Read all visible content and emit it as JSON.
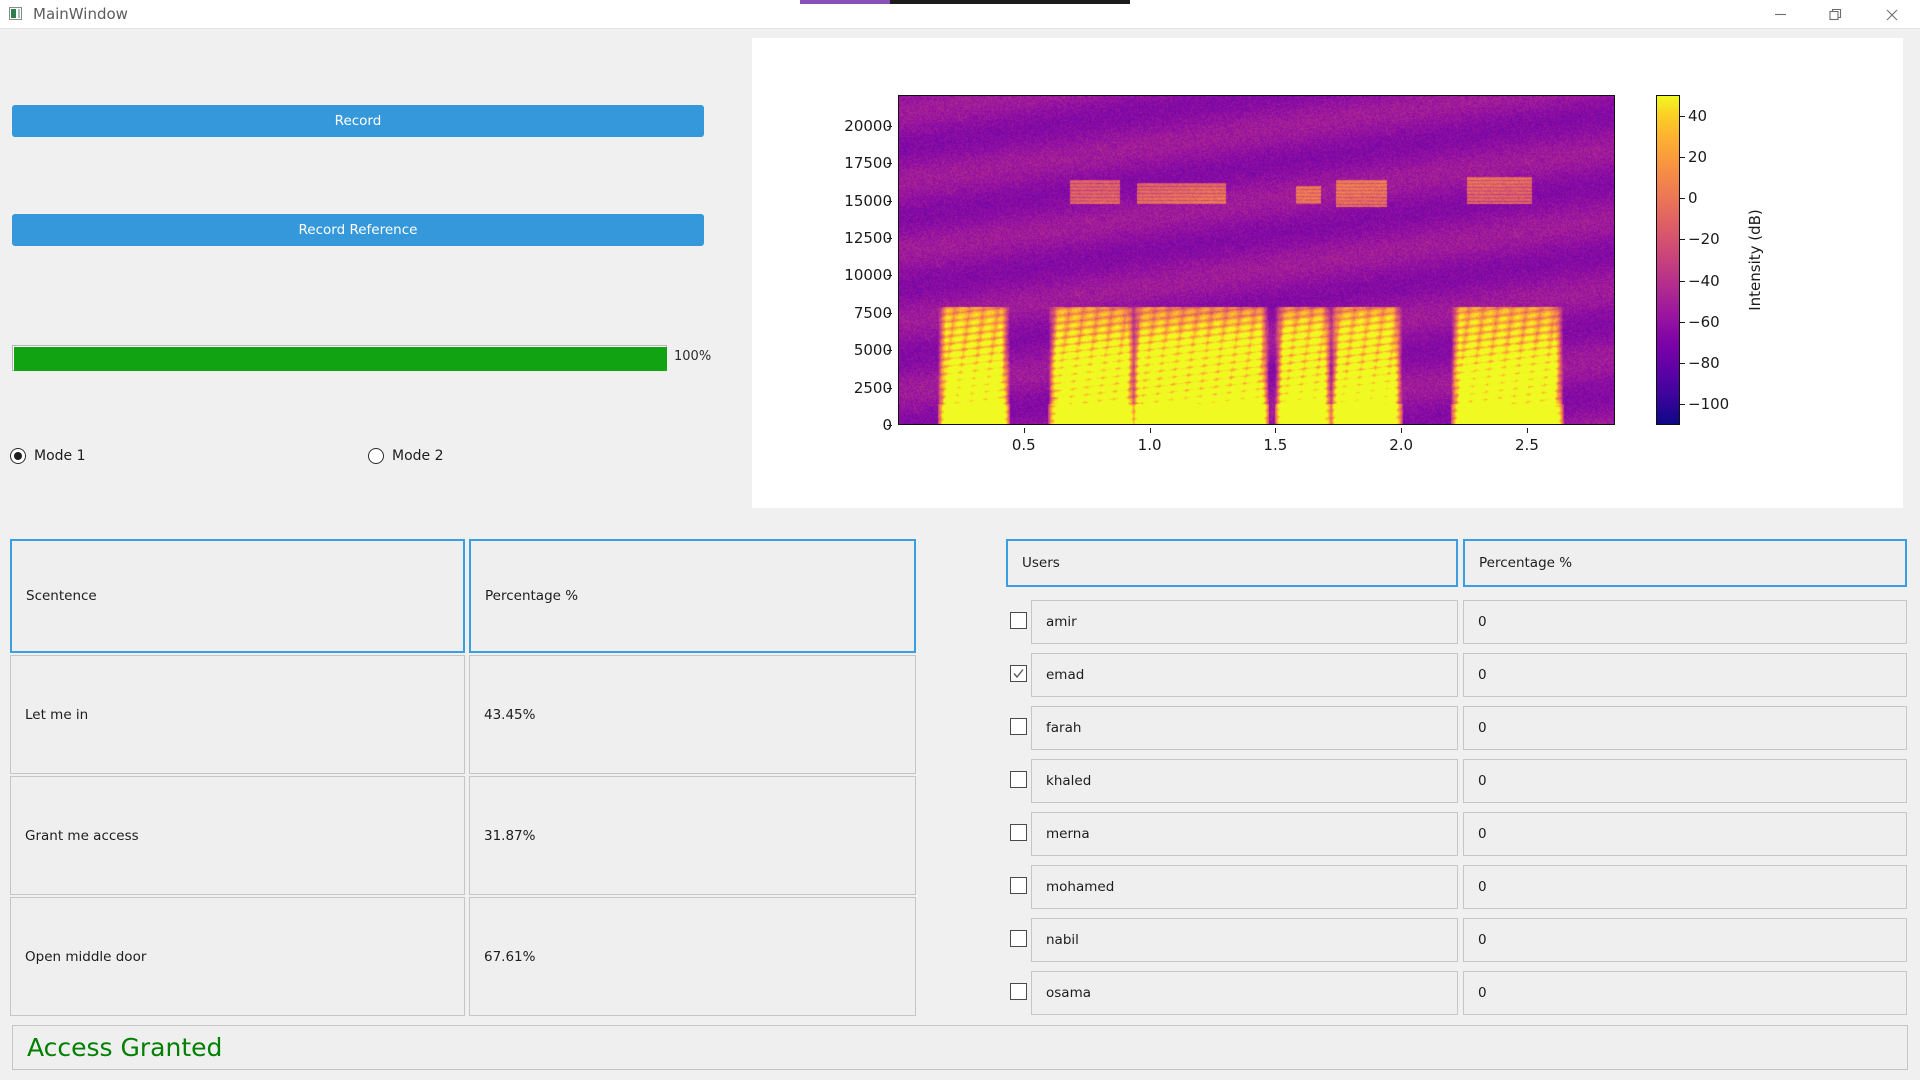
{
  "window": {
    "title": "MainWindow",
    "icon": "app-icon",
    "controls": [
      {
        "name": "minimize-button",
        "glyph": "minimize"
      },
      {
        "name": "maximize-button",
        "glyph": "restore"
      },
      {
        "name": "close-button",
        "glyph": "close"
      }
    ]
  },
  "controls": {
    "record_label": "Record",
    "record_reference_label": "Record Reference",
    "progress": {
      "value": 100,
      "label": "100%",
      "color": "#11a312"
    },
    "modes": [
      {
        "label": "Mode 1",
        "selected": true
      },
      {
        "label": "Mode 2",
        "selected": false
      }
    ],
    "accent_color": "#3498db"
  },
  "chart_data": {
    "type": "heatmap",
    "title": "",
    "xlabel": "",
    "ylabel": "",
    "colorbar_label": "Intensity (dB)",
    "colormap": "plasma",
    "xticks": [
      "0.5",
      "1.0",
      "1.5",
      "2.0",
      "2.5"
    ],
    "xtick_values": [
      0.5,
      1.0,
      1.5,
      2.0,
      2.5
    ],
    "yticks": [
      "0",
      "2500",
      "5000",
      "7500",
      "10000",
      "12500",
      "15000",
      "17500",
      "20000"
    ],
    "ytick_values": [
      0,
      2500,
      5000,
      7500,
      10000,
      12500,
      15000,
      17500,
      20000
    ],
    "xlim": [
      0.0,
      2.85
    ],
    "ylim": [
      0,
      22050
    ],
    "colorbar_ticks": [
      "40",
      "20",
      "0",
      "−20",
      "−40",
      "−60",
      "−80",
      "−100"
    ],
    "colorbar_tick_values": [
      40,
      20,
      0,
      -20,
      -40,
      -60,
      -80,
      -100
    ],
    "clim": [
      -110,
      50
    ],
    "grid": false,
    "legend": "colorbar-right",
    "description": "Audio spectrogram: speech energy concentrated below 7500 Hz with bright yellow harmonic bands, faint orange formant bands near 15000-16000 Hz, purple noise floor elsewhere.",
    "speech_segments": [
      {
        "start": 0.18,
        "end": 0.42
      },
      {
        "start": 0.62,
        "end": 0.92
      },
      {
        "start": 0.95,
        "end": 1.45
      },
      {
        "start": 1.52,
        "end": 1.7
      },
      {
        "start": 1.74,
        "end": 1.98
      },
      {
        "start": 2.22,
        "end": 2.62
      }
    ],
    "high_bands": [
      {
        "start": 0.68,
        "end": 0.88,
        "freq_lo": 14800,
        "freq_hi": 16400
      },
      {
        "start": 0.95,
        "end": 1.3,
        "freq_lo": 14800,
        "freq_hi": 16200
      },
      {
        "start": 1.58,
        "end": 1.68,
        "freq_lo": 14800,
        "freq_hi": 16000
      },
      {
        "start": 1.74,
        "end": 1.94,
        "freq_lo": 14600,
        "freq_hi": 16400
      },
      {
        "start": 2.26,
        "end": 2.52,
        "freq_lo": 14800,
        "freq_hi": 16600
      }
    ]
  },
  "sentence_table": {
    "headers": [
      "Scentence",
      "Percentage %"
    ],
    "rows": [
      {
        "sentence": "Let me in",
        "percentage": "43.45%"
      },
      {
        "sentence": "Grant me access",
        "percentage": "31.87%"
      },
      {
        "sentence": "Open middle door",
        "percentage": "67.61%"
      }
    ]
  },
  "users_table": {
    "headers": [
      "Users",
      "Percentage %"
    ],
    "rows": [
      {
        "name": "amir",
        "percentage": "0",
        "checked": false
      },
      {
        "name": "emad",
        "percentage": "0",
        "checked": true
      },
      {
        "name": "farah",
        "percentage": "0",
        "checked": false
      },
      {
        "name": "khaled",
        "percentage": "0",
        "checked": false
      },
      {
        "name": "merna",
        "percentage": "0",
        "checked": false
      },
      {
        "name": "mohamed",
        "percentage": "0",
        "checked": false
      },
      {
        "name": "nabil",
        "percentage": "0",
        "checked": false
      },
      {
        "name": "osama",
        "percentage": "0",
        "checked": false
      }
    ]
  },
  "status": {
    "text": "Access Granted",
    "color": "#008000"
  }
}
